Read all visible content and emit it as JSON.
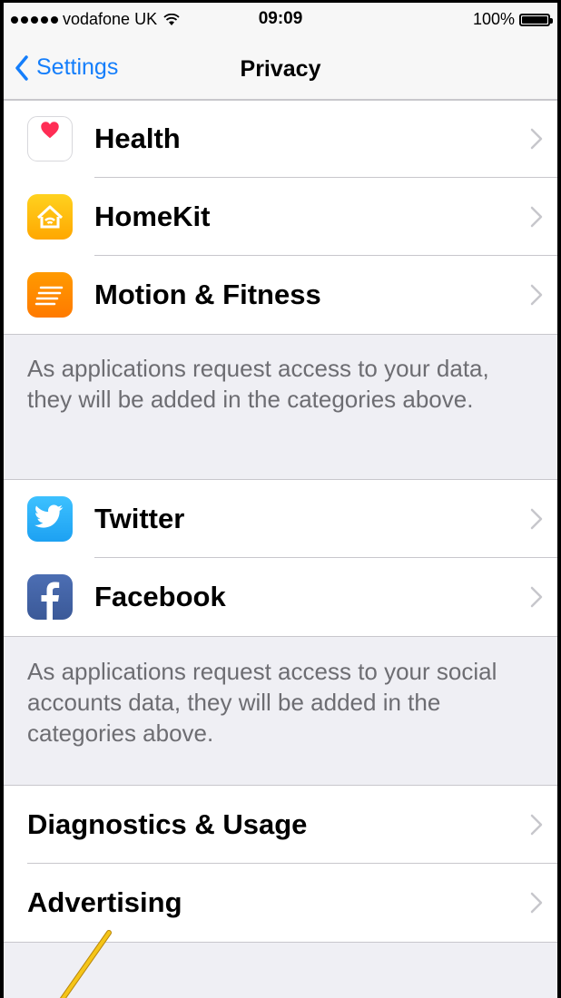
{
  "status_bar": {
    "carrier": "vodafone UK",
    "time": "09:09",
    "battery": "100%"
  },
  "nav": {
    "back_label": "Settings",
    "title": "Privacy"
  },
  "group1": {
    "items": [
      {
        "label": "Health",
        "icon": "health-icon"
      },
      {
        "label": "HomeKit",
        "icon": "homekit-icon"
      },
      {
        "label": "Motion & Fitness",
        "icon": "motion-fitness-icon"
      }
    ],
    "footer": "As applications request access to your data, they will be added in the categories above."
  },
  "group2": {
    "items": [
      {
        "label": "Twitter",
        "icon": "twitter-icon"
      },
      {
        "label": "Facebook",
        "icon": "facebook-icon"
      }
    ],
    "footer": "As applications request access to your social accounts data, they will be added in the categories above."
  },
  "group3": {
    "items": [
      {
        "label": "Diagnostics & Usage"
      },
      {
        "label": "Advertising"
      }
    ]
  },
  "colors": {
    "accent": "#147efb",
    "background": "#efeff4",
    "annotation_line": "#f5c518"
  }
}
